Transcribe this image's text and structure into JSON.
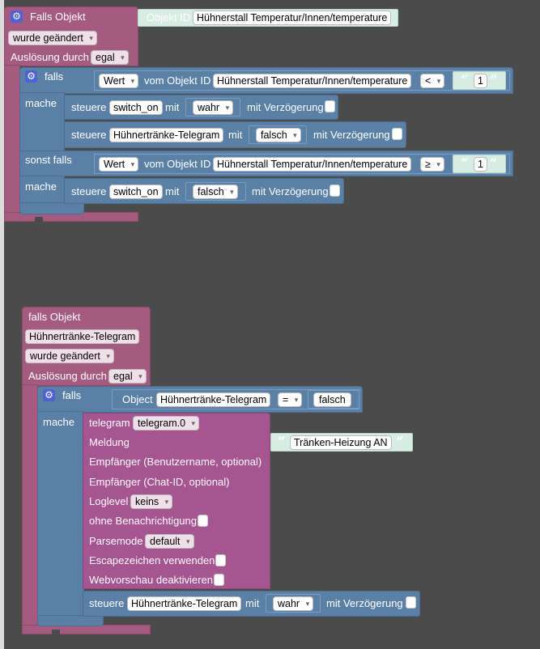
{
  "block1": {
    "hat_label": "Falls Objekt",
    "objid_label": "Objekt ID",
    "objid_value": "Hühnerstall Temperatur/Innen/temperature",
    "changed": "wurde geändert",
    "trigger_label": "Auslösung durch",
    "trigger_value": "egal",
    "if_label": "falls",
    "value_dd": "Wert",
    "of_objid_label": "vom Objekt ID",
    "cond1_obj": "Hühnerstall Temperatur/Innen/temperature",
    "cond1_op": "<",
    "cond1_val": "1",
    "do_label": "mache",
    "s1_label": "steuere",
    "s1_obj": "switch_on",
    "s1_with": "mit",
    "s1_val": "wahr",
    "s1_delay": "mit Verzögerung",
    "s2_label": "steuere",
    "s2_obj": "Hühnertränke-Telegram",
    "s2_with": "mit",
    "s2_val": "falsch",
    "s2_delay": "mit Verzögerung",
    "elseif_label": "sonst falls",
    "cond2_obj": "Hühnerstall Temperatur/Innen/temperature",
    "cond2_op": "≥",
    "cond2_val": "1",
    "do2_label": "mache",
    "s3_label": "steuere",
    "s3_obj": "switch_on",
    "s3_with": "mit",
    "s3_val": "falsch",
    "s3_delay": "mit Verzögerung"
  },
  "block2": {
    "hat_label": "falls Objekt",
    "obj_value": "Hühnertränke-Telegram",
    "changed": "wurde geändert",
    "trigger_label": "Auslösung durch",
    "trigger_value": "egal",
    "if_label": "falls",
    "obj_label": "Object",
    "cond_obj": "Hühnertränke-Telegram",
    "cond_op": "=",
    "cond_val": "falsch",
    "do_label": "mache",
    "tg_label": "telegram",
    "tg_instance": "telegram.0",
    "msg_label": "Meldung",
    "msg_text": "Tränken-Heizung AN",
    "recipient_user_label": "Empfänger (Benutzername, optional)",
    "recipient_chat_label": "Empfänger (Chat-ID, optional)",
    "loglevel_label": "Loglevel",
    "loglevel_value": "keins",
    "silent_label": "ohne Benachrichtigung",
    "parse_label": "Parsemode",
    "parse_value": "default",
    "escape_label": "Escapezeichen verwenden",
    "webpreview_label": "Webvorschau deaktivieren",
    "s_label": "steuere",
    "s_obj": "Hühnertränke-Telegram",
    "s_with": "mit",
    "s_val": "wahr",
    "s_delay": "mit Verzögerung"
  },
  "icons": {
    "gear": "gear-icon",
    "quote_open": "“",
    "quote_close": "”"
  },
  "colors": {
    "event_block": "#a55b80",
    "logic_block": "#5b80a5",
    "text_block": "#d7ede3",
    "telegram_block": "#a5558f",
    "canvas": "#4b4b4b"
  }
}
